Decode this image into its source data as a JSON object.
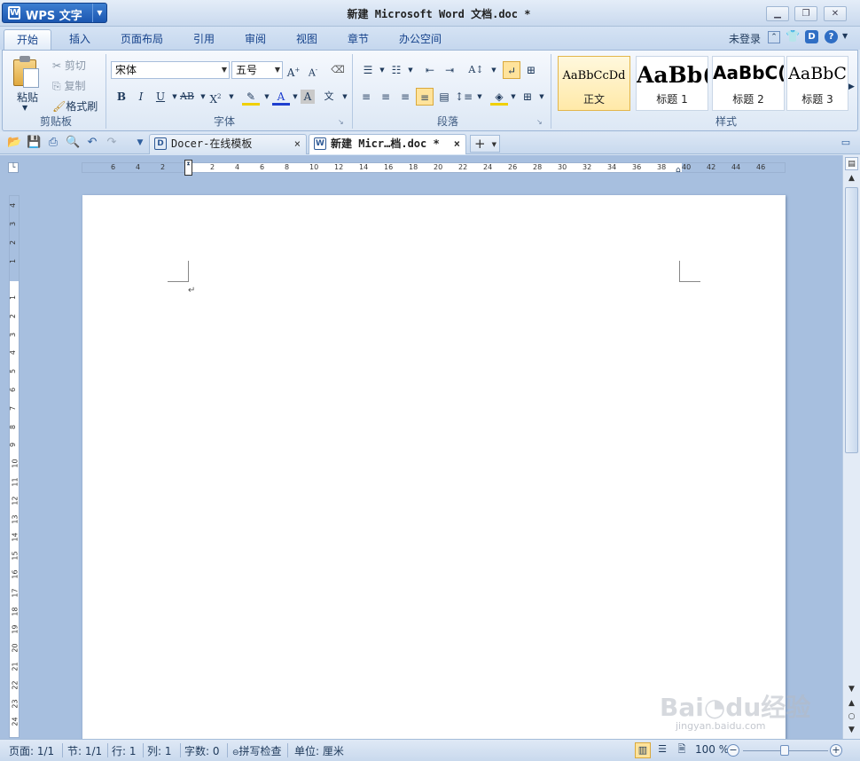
{
  "app": {
    "name": "WPS 文字",
    "logo": "W"
  },
  "title": "新建 Microsoft Word 文档.doc *",
  "window_controls": [
    "minimize-icon",
    "restore-icon",
    "close-icon"
  ],
  "tabs": [
    "开始",
    "插入",
    "页面布局",
    "引用",
    "审阅",
    "视图",
    "章节",
    "办公空间"
  ],
  "active_tab": "开始",
  "login": "未登录",
  "clipboard": {
    "paste": "粘贴",
    "cut": "剪切",
    "copy": "复制",
    "format_painter": "格式刷",
    "group": "剪贴板"
  },
  "font": {
    "family": "宋体",
    "size": "五号",
    "group": "字体"
  },
  "paragraph": {
    "group": "段落"
  },
  "styles": {
    "group": "样式",
    "items": [
      {
        "sample": "AaBbCcDd",
        "label": "正文"
      },
      {
        "sample": "AaBb(",
        "label": "标题 1"
      },
      {
        "sample": "AaBbC(",
        "label": "标题 2"
      },
      {
        "sample": "AaBbC",
        "label": "标题 3"
      }
    ]
  },
  "doc_tabs": [
    {
      "label": "Docer-在线模板",
      "icon": "D"
    },
    {
      "label": "新建 Micr…档.doc *",
      "icon": "W"
    }
  ],
  "ruler": {
    "h_ticks": [
      "6",
      "4",
      "2",
      "2",
      "4",
      "6",
      "8",
      "10",
      "12",
      "14",
      "16",
      "18",
      "20",
      "22",
      "24",
      "26",
      "28",
      "30",
      "32",
      "34",
      "36",
      "38",
      "40",
      "42",
      "44",
      "46"
    ],
    "v_ticks": [
      "4",
      "3",
      "2",
      "1",
      "1",
      "2",
      "3",
      "4",
      "5",
      "6",
      "7",
      "8",
      "9",
      "10",
      "11",
      "12",
      "13",
      "14",
      "15",
      "16",
      "17",
      "18",
      "19",
      "20",
      "21",
      "22",
      "23",
      "24"
    ]
  },
  "status": {
    "page": "页面: 1/1",
    "section": "节: 1/1",
    "row": "行: 1",
    "col": "列: 1",
    "words": "字数: 0",
    "spell": "拼写检查",
    "unit": "单位: 厘米",
    "zoom": "100 %"
  },
  "watermark": "Baidu经验 jingyan.baidu.com"
}
